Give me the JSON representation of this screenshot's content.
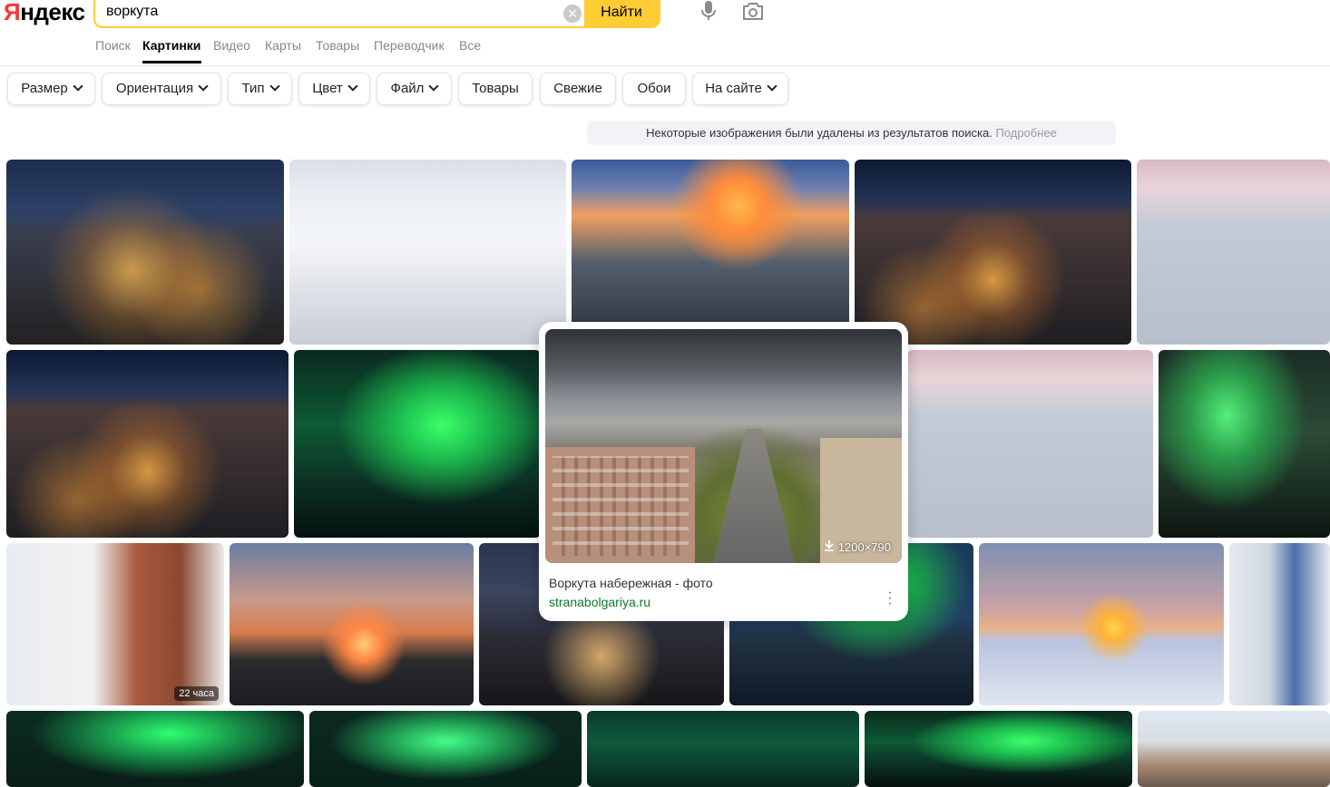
{
  "header": {
    "logo_text_red": "Я",
    "logo_text_black": "ндекс",
    "search_value": "воркута",
    "clear_icon": "close-circle-icon",
    "find_label": "Найти",
    "mic_icon": "microphone-icon",
    "camera_icon": "camera-search-icon"
  },
  "tabs": [
    {
      "label": "Поиск",
      "active": false
    },
    {
      "label": "Картинки",
      "active": true
    },
    {
      "label": "Видео",
      "active": false
    },
    {
      "label": "Карты",
      "active": false
    },
    {
      "label": "Товары",
      "active": false
    },
    {
      "label": "Переводчик",
      "active": false
    },
    {
      "label": "Все",
      "active": false
    }
  ],
  "filters": [
    {
      "label": "Размер",
      "dropdown": true
    },
    {
      "label": "Ориентация",
      "dropdown": true
    },
    {
      "label": "Тип",
      "dropdown": true
    },
    {
      "label": "Цвет",
      "dropdown": true
    },
    {
      "label": "Файл",
      "dropdown": true
    },
    {
      "label": "Товары",
      "dropdown": false
    },
    {
      "label": "Свежие",
      "dropdown": false
    },
    {
      "label": "Обои",
      "dropdown": false
    },
    {
      "label": "На сайте",
      "dropdown": true
    }
  ],
  "notice": {
    "text": "Некоторые изображения были удалены из результатов поиска.",
    "link": "Подробнее"
  },
  "tiles": {
    "office_badge": "22 часа"
  },
  "popup": {
    "dimensions": "1200×790",
    "title": "Воркута набережная - фото",
    "site": "stranabolgariya.ru",
    "more_icon": "more-vertical-icon"
  },
  "colors": {
    "accent_yellow": "#ffcc33",
    "logo_red": "#ff3333",
    "site_green": "#0a7a2a"
  }
}
